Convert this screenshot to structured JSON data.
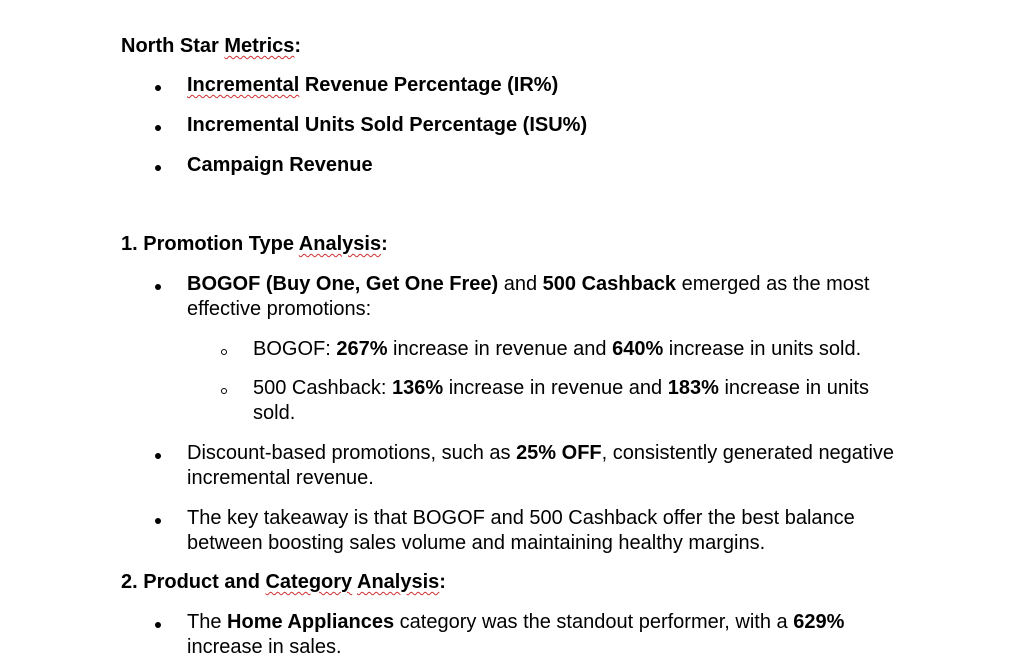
{
  "north_star": {
    "heading_plain": "North Star ",
    "heading_squiggle": "Metrics",
    "heading_colon": ":",
    "items": [
      {
        "squiggle": "Incremental",
        "rest": " Revenue Percentage (IR%)"
      },
      {
        "text": "Incremental Units Sold Percentage (ISU%)"
      },
      {
        "text": "Campaign Revenue"
      }
    ]
  },
  "section1": {
    "heading_plain": "1. Promotion Type ",
    "heading_squiggle": "Analysis",
    "heading_colon": ":",
    "b1": {
      "bold1": "BOGOF (Buy One, Get One Free)",
      "t1": " and ",
      "bold2": "500 Cashback",
      "t2": " emerged as the most effective promotions:"
    },
    "sub1": {
      "t1": "BOGOF: ",
      "bold1": "267%",
      "t2": " increase in revenue and ",
      "bold2": "640%",
      "t3": " increase in units sold."
    },
    "sub2": {
      "t1": "500 Cashback: ",
      "bold1": "136%",
      "t2": " increase in revenue and ",
      "bold2": "183%",
      "t3": " increase in units sold."
    },
    "b2": {
      "t1": "Discount-based promotions, such as ",
      "bold1": "25% OFF",
      "t2": ", consistently generated negative incremental revenue."
    },
    "b3": {
      "text": "The key takeaway is that BOGOF and 500 Cashback offer the best balance between boosting sales volume and maintaining healthy margins."
    }
  },
  "section2": {
    "heading_plain": "2. Product and ",
    "heading_squiggle1": "Category",
    "heading_space": " ",
    "heading_squiggle2": "Analysis",
    "heading_colon": ":",
    "b1": {
      "t1": "The ",
      "bold1": "Home Appliances",
      "t2": " category was the standout performer, with a ",
      "bold2": "629%",
      "t3": " increase in sales."
    }
  }
}
